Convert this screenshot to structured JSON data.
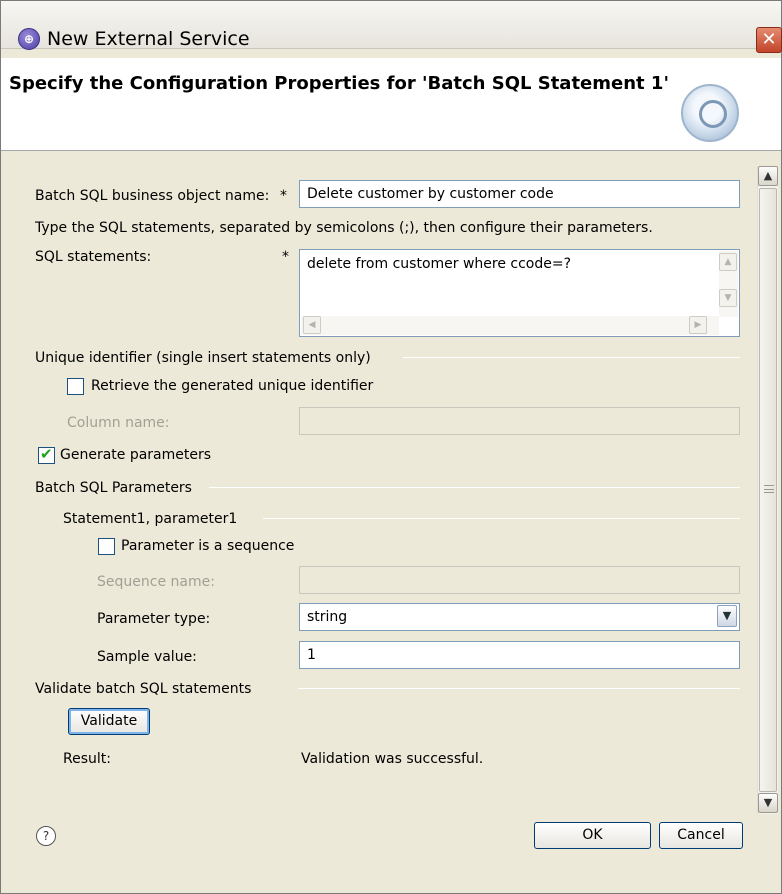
{
  "window": {
    "title": "New External Service"
  },
  "banner": {
    "title": "Specify the Configuration Properties for 'Batch SQL Statement 1'"
  },
  "form": {
    "bo_name_label": "Batch SQL business object name:",
    "required_star": "*",
    "bo_name_value": "Delete customer by customer code",
    "instructions": "Type the SQL statements, separated by semicolons (;), then configure their parameters.",
    "sql_label": "SQL statements:",
    "sql_value": "delete from customer where ccode=?",
    "unique_group": "Unique identifier (single insert statements only)",
    "retrieve_label": "Retrieve the generated unique identifier",
    "retrieve_checked": false,
    "column_name_label": "Column name:",
    "column_name_value": "",
    "generate_label": "Generate parameters",
    "generate_checked": true,
    "params_group": "Batch SQL Parameters",
    "statement_group": "Statement1, parameter1",
    "sequence_label": "Parameter is a sequence",
    "sequence_checked": false,
    "sequence_name_label": "Sequence name:",
    "sequence_name_value": "",
    "param_type_label": "Parameter type:",
    "param_type_value": "string",
    "sample_label": "Sample value:",
    "sample_value": "1",
    "validate_group": "Validate batch SQL statements",
    "validate_button": "Validate",
    "result_label": "Result:",
    "result_value": "Validation was successful."
  },
  "footer": {
    "help": "?",
    "ok": "OK",
    "cancel": "Cancel"
  },
  "icons": {
    "title": "service-icon",
    "close": "close-icon",
    "wizard": "wizard-banner-icon",
    "scroll_up": "scroll-up-arrow-icon",
    "scroll_down": "scroll-down-arrow-icon",
    "combo": "chevron-down-icon",
    "help": "help-icon"
  },
  "colors": {
    "close_button": "#c2452a",
    "checkmark": "#21a121",
    "field_border": "#7f9db9"
  }
}
